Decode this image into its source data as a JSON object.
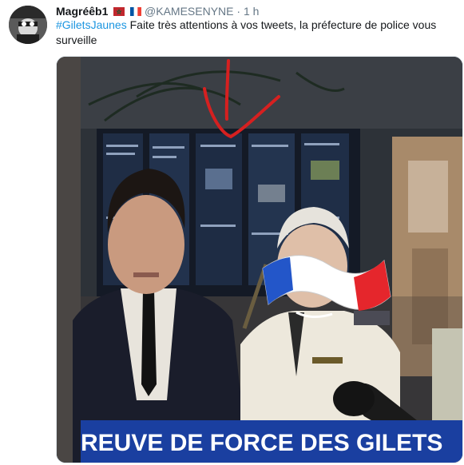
{
  "tweet": {
    "display_name": "Magréêb1",
    "handle": "@KAMESENYNE",
    "separator": "·",
    "time": "1 h",
    "hashtag": "#GiletsJaunes",
    "text": " Faite très attentions à vos tweets, la préfecture de police vous surveille"
  },
  "media": {
    "banner_text": "REUVE DE FORCE DES GILETS"
  },
  "icons": [
    "morocco-flag-icon",
    "france-flag-icon",
    "red-arrow-annotation",
    "france-flag-sticker"
  ],
  "colors": {
    "hashtag": "#1b95e0",
    "name": "#14171a",
    "meta": "#657786",
    "banner": "#1a3fa0"
  }
}
